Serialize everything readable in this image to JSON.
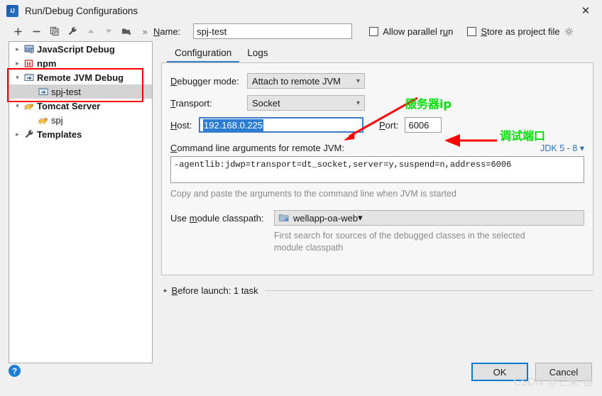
{
  "window": {
    "title": "Run/Debug Configurations",
    "logo_text": "IJ",
    "close_label": "✕"
  },
  "toolbar": {
    "items": [
      {
        "name": "add-button",
        "glyph": "+"
      },
      {
        "name": "remove-button",
        "glyph": "−"
      },
      {
        "name": "copy-button",
        "glyph": "copy"
      },
      {
        "name": "edit-templates-button",
        "glyph": "wrench"
      },
      {
        "name": "move-up-button",
        "glyph": "up"
      },
      {
        "name": "move-down-button",
        "glyph": "down"
      },
      {
        "name": "move-into-folder-button",
        "glyph": "folder-add"
      },
      {
        "name": "more-button",
        "glyph": "»"
      }
    ]
  },
  "header": {
    "name_label": "Name:",
    "name_value": "spj-test",
    "allow_parallel_run_label": "Allow parallel run",
    "allow_parallel_run_checked": false,
    "store_as_project_file_label": "Store as project file",
    "store_as_project_file_checked": false
  },
  "tree": {
    "items": [
      {
        "label": "JavaScript Debug",
        "level": 0,
        "expanded": false,
        "bold": true,
        "selected": false,
        "icon": "javascript-debug-icon"
      },
      {
        "label": "npm",
        "level": 0,
        "expanded": false,
        "bold": true,
        "selected": false,
        "icon": "npm-icon"
      },
      {
        "label": "Remote JVM Debug",
        "level": 0,
        "expanded": true,
        "bold": true,
        "selected": false,
        "icon": "remote-jvm-icon"
      },
      {
        "label": "spj-test",
        "level": 1,
        "expanded": null,
        "bold": false,
        "selected": true,
        "icon": "remote-jvm-icon"
      },
      {
        "label": "Tomcat Server",
        "level": 0,
        "expanded": true,
        "bold": true,
        "selected": false,
        "icon": "tomcat-icon"
      },
      {
        "label": "spj",
        "level": 1,
        "expanded": null,
        "bold": false,
        "selected": false,
        "icon": "tomcat-icon"
      },
      {
        "label": "Templates",
        "level": 0,
        "expanded": false,
        "bold": true,
        "selected": false,
        "icon": "templates-icon"
      }
    ]
  },
  "tabs": [
    {
      "label": "Configuration",
      "active": true
    },
    {
      "label": "Logs",
      "active": false
    }
  ],
  "config": {
    "debugger_mode_label": "Debugger mode:",
    "debugger_mode_value": "Attach to remote JVM",
    "transport_label": "Transport:",
    "transport_value": "Socket",
    "host_label": "Host:",
    "host_value": "192.168.0.225",
    "port_label": "Port:",
    "port_value": "6006",
    "args_label": "Command line arguments for remote JVM:",
    "jdk_selector": "JDK 5 - 8",
    "args_value": "-agentlib:jdwp=transport=dt_socket,server=y,suspend=n,address=6006",
    "args_hint": "Copy and paste the arguments to the command line when JVM is started",
    "module_classpath_label": "Use module classpath:",
    "module_classpath_value": "wellapp-oa-web",
    "module_hint_line1": "First search for sources of the debugged classes in the selected",
    "module_hint_line2": "module classpath"
  },
  "before_launch": {
    "label": "Before launch: 1 task"
  },
  "footer": {
    "help_label": "?",
    "ok_label": "OK",
    "cancel_label": "Cancel"
  },
  "annotations": {
    "server_ip": "服务器ip",
    "debug_port": "调试端口",
    "watermark": "CSDN @芒果-橙"
  },
  "colors": {
    "accent": "#3d7cc9",
    "selection": "#2b7cd3",
    "annotation_red": "#ff0000",
    "annotation_green": "#00e000",
    "link": "#2f6fb5"
  }
}
